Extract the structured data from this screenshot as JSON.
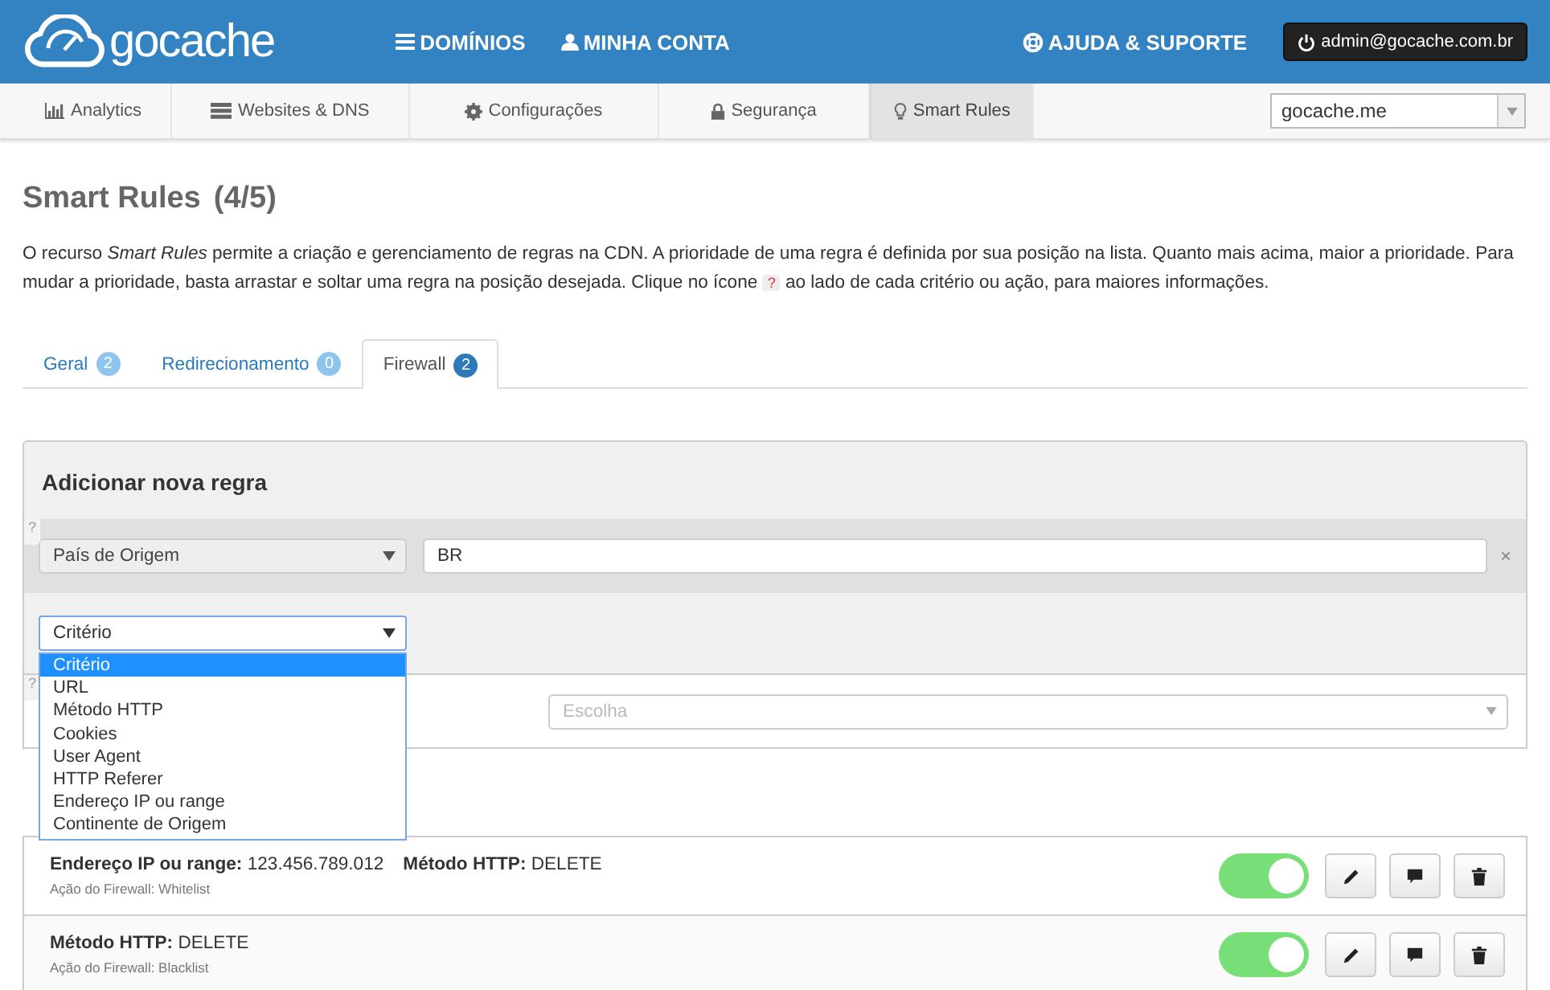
{
  "header": {
    "logo": "gocache",
    "nav": [
      {
        "label": "DOMÍNIOS"
      },
      {
        "label": "MINHA CONTA"
      },
      {
        "label": "AJUDA & SUPORTE"
      }
    ],
    "account": "admin@gocache.com.br"
  },
  "subnav": {
    "tabs": [
      {
        "label": "Analytics",
        "selected": false
      },
      {
        "label": "Websites & DNS",
        "selected": false
      },
      {
        "label": "Configurações",
        "selected": false
      },
      {
        "label": "Segurança",
        "selected": false
      },
      {
        "label": "Smart Rules",
        "selected": true
      }
    ],
    "site_select": "gocache.me"
  },
  "page": {
    "title": "Smart Rules",
    "count": "(4/5)",
    "description_before": "O recurso *Smart Rules* permite a criação e gerenciamento de regras na CDN. A prioridade de uma regra é definida por sua posição na lista. Quanto mais acima, maior a prioridade. Para mudar a prioridade, basta arrastar e soltar uma regra na posição desejada. Clique no ícone",
    "help_badge": "?",
    "description_after": "ao lado de cada critério ou ação, para maiores informações."
  },
  "tabs": [
    {
      "label": "Geral",
      "count": "2",
      "selected": false
    },
    {
      "label": "Redirecionamento",
      "count": "0",
      "selected": false
    },
    {
      "label": "Firewall",
      "count": "2",
      "selected": true
    }
  ],
  "new_rule": {
    "title": "Adicionar nova regra",
    "criterion_help": "?",
    "criterion_select": "País de Origem",
    "criterion_value": "BR",
    "remove": "×",
    "add_select": "Critério",
    "action_help": "?",
    "action_placeholder": "Escolha",
    "dropdown": [
      {
        "label": "Critério",
        "selected": true
      },
      {
        "label": "URL",
        "selected": false
      },
      {
        "label": "Método HTTP",
        "selected": false
      },
      {
        "label": "Cookies",
        "selected": false
      },
      {
        "label": "User Agent",
        "selected": false
      },
      {
        "label": "HTTP Referer",
        "selected": false
      },
      {
        "label": "Endereço IP ou range",
        "selected": false
      },
      {
        "label": "Continente de Origem",
        "selected": false
      }
    ]
  },
  "rules": [
    {
      "criteria": [
        {
          "label": "Endereço IP ou range:",
          "value": "123.456.789.012"
        },
        {
          "label": "Método HTTP:",
          "value": "DELETE"
        }
      ],
      "action": "Ação do Firewall: Whitelist",
      "on": true
    },
    {
      "criteria": [
        {
          "label": "Método HTTP:",
          "value": "DELETE"
        }
      ],
      "action": "Ação do Firewall: Blacklist",
      "on": true
    }
  ]
}
